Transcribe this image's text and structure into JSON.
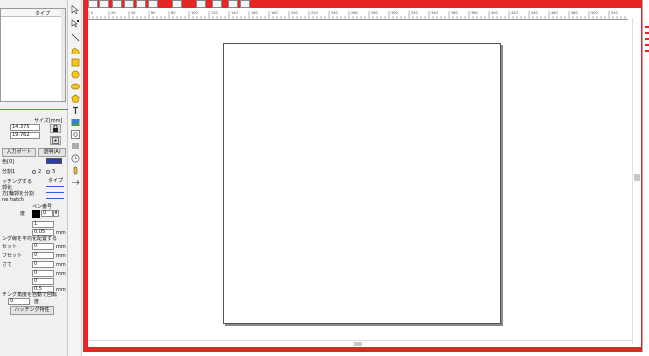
{
  "left_panel": {
    "list_header_type": "タイプ",
    "size_header": "サイズ[mm]",
    "width_value": "14.375",
    "height_value": "19.762",
    "input_port_button": "入力ポート",
    "opacity_button": "透明(A)",
    "color_label": "色[0]",
    "radio_label": "分割1",
    "radio_opt_2": "2",
    "radio_opt_3": "3",
    "hatch_label": "ッチングする",
    "hatch_type_label": "タイプ",
    "hatch_row1": "郭化",
    "hatch_row2": "方[輪郭を分割",
    "hatch_row3": "ne hatch",
    "pen_color_label": "ペン番号",
    "pen_number_value": "0",
    "angle_label": "度",
    "pitch_value": "1",
    "line_spacing_value": "0.05",
    "unit_mm": "mm",
    "even_label": "ング線を平均化配置する",
    "offset_label": "セット",
    "offset_value": "0",
    "offset2_label": "フセット",
    "offset2_value": "0",
    "end_label": "さて",
    "end_value": "0",
    "extra_value": "0",
    "extra2_value": "0",
    "bottom_value": "0.5",
    "auto_rotate_label": "チング角度を自動で回転",
    "degree_label": "度",
    "degree_value": "0",
    "hatch_settings_button": "ハッチング特性"
  },
  "tools": [
    "select-arrow-icon",
    "node-edit-icon",
    "line-icon",
    "bezier-icon",
    "rectangle-icon",
    "circle-icon",
    "ellipse-icon",
    "polygon-icon",
    "text-icon",
    "image-icon",
    "barcode-icon",
    "hatch-icon",
    "timer-icon",
    "input-icon",
    "output-icon"
  ],
  "ruler": {
    "ticks": [
      "0",
      "20",
      "40",
      "60",
      "80",
      "100",
      "120",
      "140",
      "160",
      "180",
      "200",
      "220",
      "240",
      "260",
      "280",
      "300",
      "320",
      "340",
      "360",
      "380",
      "400",
      "420",
      "440",
      "460",
      "480",
      "500",
      "520",
      "540"
    ]
  },
  "colors": {
    "frame_red": "#e52624",
    "pen_blue": "#2a3da8",
    "hatch_blue": "#3a5bd8"
  }
}
